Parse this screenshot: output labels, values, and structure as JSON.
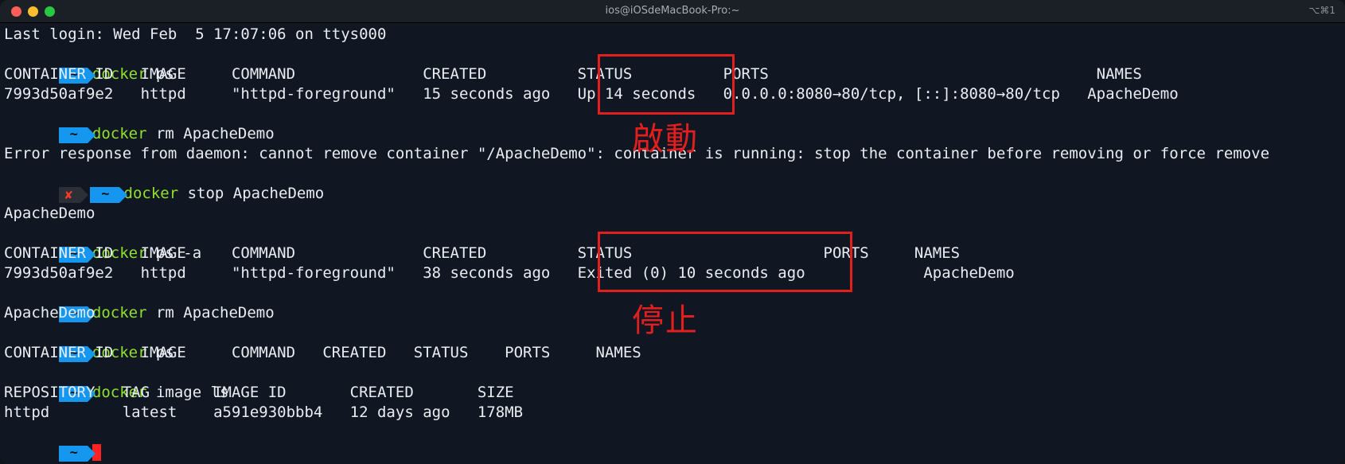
{
  "window": {
    "title": "ios@iOSdeMacBook-Pro:~",
    "shortcut": "⌥⌘1"
  },
  "prompt": {
    "symbol": "~",
    "error_symbol": "✘"
  },
  "lines": {
    "l01": "Last login: Wed Feb  5 17:07:06 on ttys000",
    "l02_cmd": "docker",
    "l02_args": " ps",
    "l03": "CONTAINER ID   IMAGE     COMMAND              CREATED          STATUS          PORTS                                    NAMES",
    "l04": "7993d50af9e2   httpd     \"httpd-foreground\"   15 seconds ago   Up 14 seconds   0.0.0.0:8080→80/tcp, [::]:8080→80/tcp   ApacheDemo",
    "l05_cmd": "docker",
    "l05_args": " rm ApacheDemo",
    "l06": "",
    "l07": "Error response from daemon: cannot remove container \"/ApacheDemo\": container is running: stop the container before removing or force remove",
    "l08_cmd": "docker",
    "l08_args": " stop ApacheDemo",
    "l09": "",
    "l10": "ApacheDemo",
    "l11_cmd": "docker",
    "l11_args": " ps -a",
    "l12": "CONTAINER ID   IMAGE     COMMAND              CREATED          STATUS                     PORTS     NAMES",
    "l13": "7993d50af9e2   httpd     \"httpd-foreground\"   38 seconds ago   Exited (0) 10 seconds ago             ApacheDemo",
    "l14_cmd": "docker",
    "l14_args": " rm ApacheDemo",
    "l15": "ApacheDemo",
    "l16_cmd": "docker",
    "l16_args": " ps",
    "l17": "CONTAINER ID   IMAGE     COMMAND   CREATED   STATUS    PORTS     NAMES",
    "l18_cmd": "docker",
    "l18_args": " image ls",
    "l19": "REPOSITORY   TAG       IMAGE ID       CREATED       SIZE",
    "l20": "httpd        latest    a591e930bbb4   12 days ago   178MB"
  },
  "annotations": {
    "running_label": "啟動",
    "stopped_label": "停止",
    "color": "#e31e1e"
  },
  "colors": {
    "background": "#111722",
    "prompt_badge": "#1597f0",
    "command": "#8fe031",
    "error_mark": "#ff3b30",
    "cursor": "#ff2222"
  }
}
